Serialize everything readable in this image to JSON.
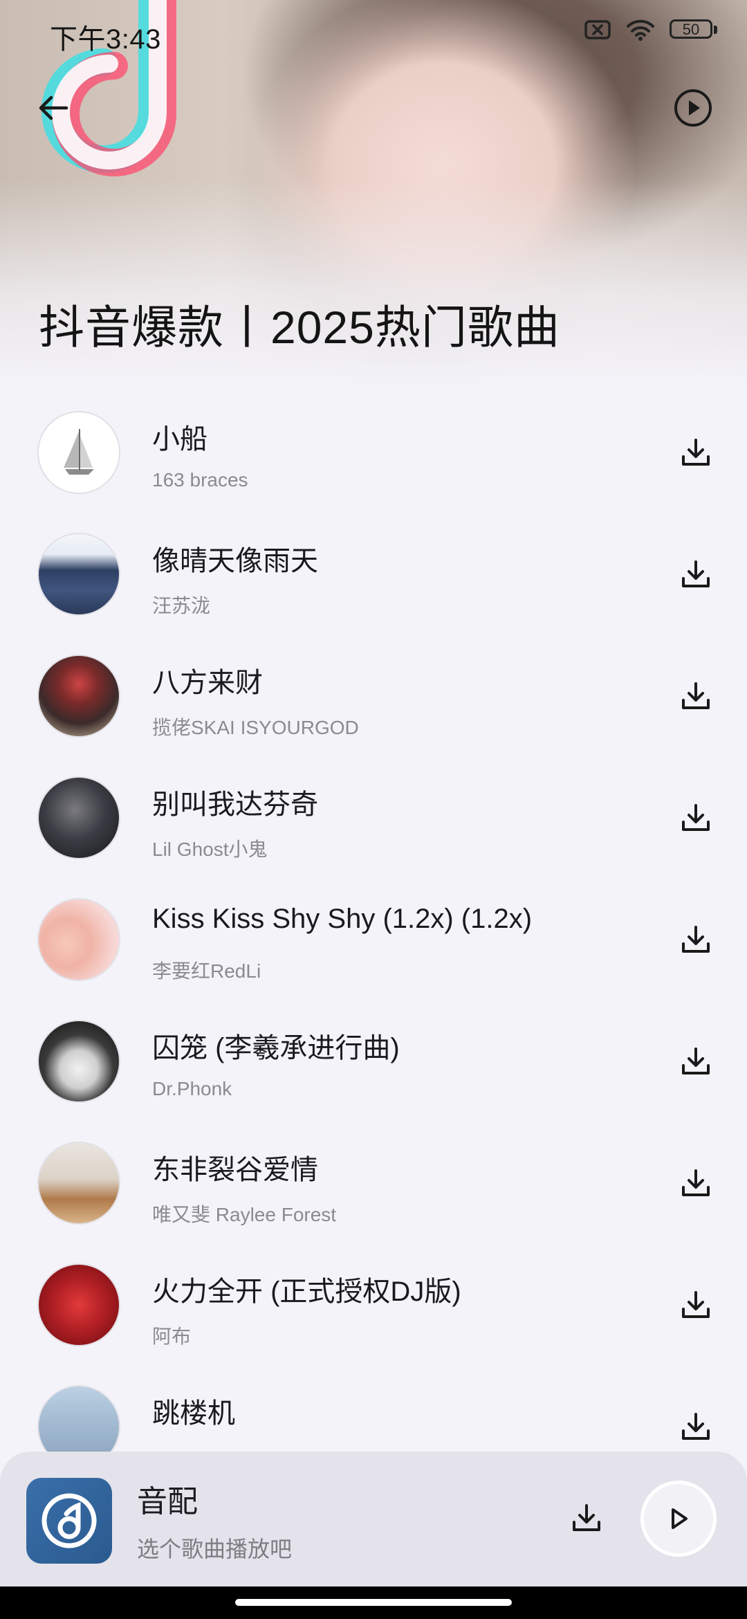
{
  "status_bar": {
    "time": "下午3:43",
    "battery": "50"
  },
  "header": {
    "back_icon": "arrow-left-icon",
    "play_icon": "play-circle-icon",
    "title": "抖音爆款丨2025热门歌曲"
  },
  "songs": [
    {
      "title": "小船",
      "artist": "163 braces"
    },
    {
      "title": "像晴天像雨天",
      "artist": "汪苏泷"
    },
    {
      "title": "八方来财",
      "artist": "揽佬SKAI ISYOURGOD"
    },
    {
      "title": "别叫我达芬奇",
      "artist": "Lil Ghost小鬼"
    },
    {
      "title": "Kiss Kiss Shy Shy (1.2x) (1.2x)",
      "artist": "李要红RedLi"
    },
    {
      "title": "囚笼 (李羲承进行曲)",
      "artist": "Dr.Phonk"
    },
    {
      "title": "东非裂谷爱情",
      "artist": "唯又斐 Raylee Forest"
    },
    {
      "title": "火力全开 (正式授权DJ版)",
      "artist": "阿布"
    },
    {
      "title": "跳楼机",
      "artist": ""
    }
  ],
  "mini_player": {
    "title": "音配",
    "subtitle": "选个歌曲播放吧"
  },
  "colors": {
    "background": "#f4f3f9",
    "player_bg": "#e4e3eb",
    "text": "#1b1b1f",
    "subtext": "#8a8a90"
  }
}
